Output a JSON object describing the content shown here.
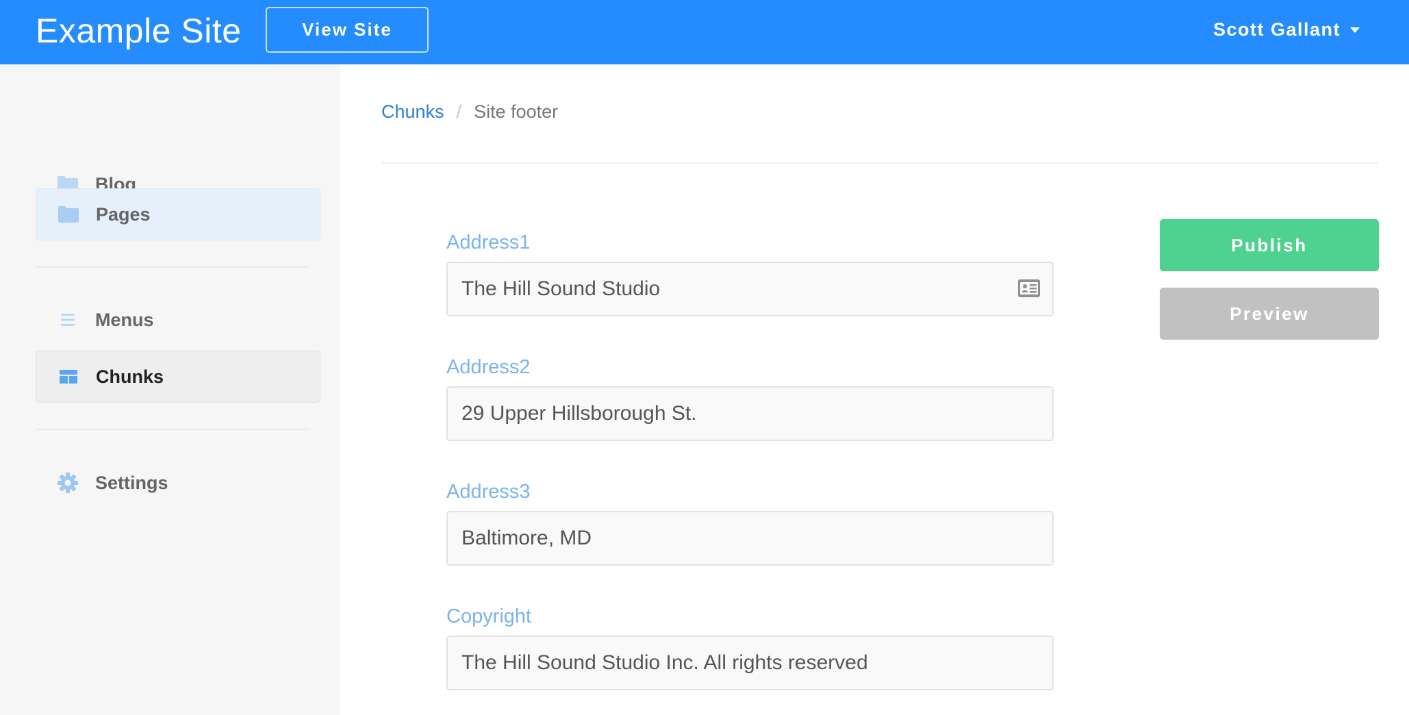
{
  "header": {
    "site_title": "Example Site",
    "view_site_label": "View Site",
    "user_name": "Scott Gallant"
  },
  "sidebar": {
    "items": [
      {
        "label": "Blog",
        "icon": "folder-icon"
      },
      {
        "label": "Pages",
        "icon": "folder-icon",
        "selected": true
      },
      {
        "label": "Menus",
        "icon": "list-icon"
      },
      {
        "label": "Chunks",
        "icon": "table-layout-icon",
        "current": true
      },
      {
        "label": "Settings",
        "icon": "gear-icon"
      }
    ]
  },
  "breadcrumb": {
    "parent": "Chunks",
    "separator": "/",
    "current": "Site footer"
  },
  "form": {
    "fields": [
      {
        "label": "Address1",
        "value": "The Hill Sound Studio"
      },
      {
        "label": "Address2",
        "value": "29 Upper Hillsborough St."
      },
      {
        "label": "Address3",
        "value": "Baltimore, MD"
      },
      {
        "label": "Copyright",
        "value": "The Hill Sound Studio Inc. All rights reserved"
      }
    ]
  },
  "actions": {
    "publish_label": "Publish",
    "preview_label": "Preview"
  },
  "colors": {
    "brand": "#248cfe",
    "publish": "#4fd18f",
    "preview": "#c1c1c1",
    "field_label": "#7ab4ef",
    "link": "#2b7fd4"
  }
}
